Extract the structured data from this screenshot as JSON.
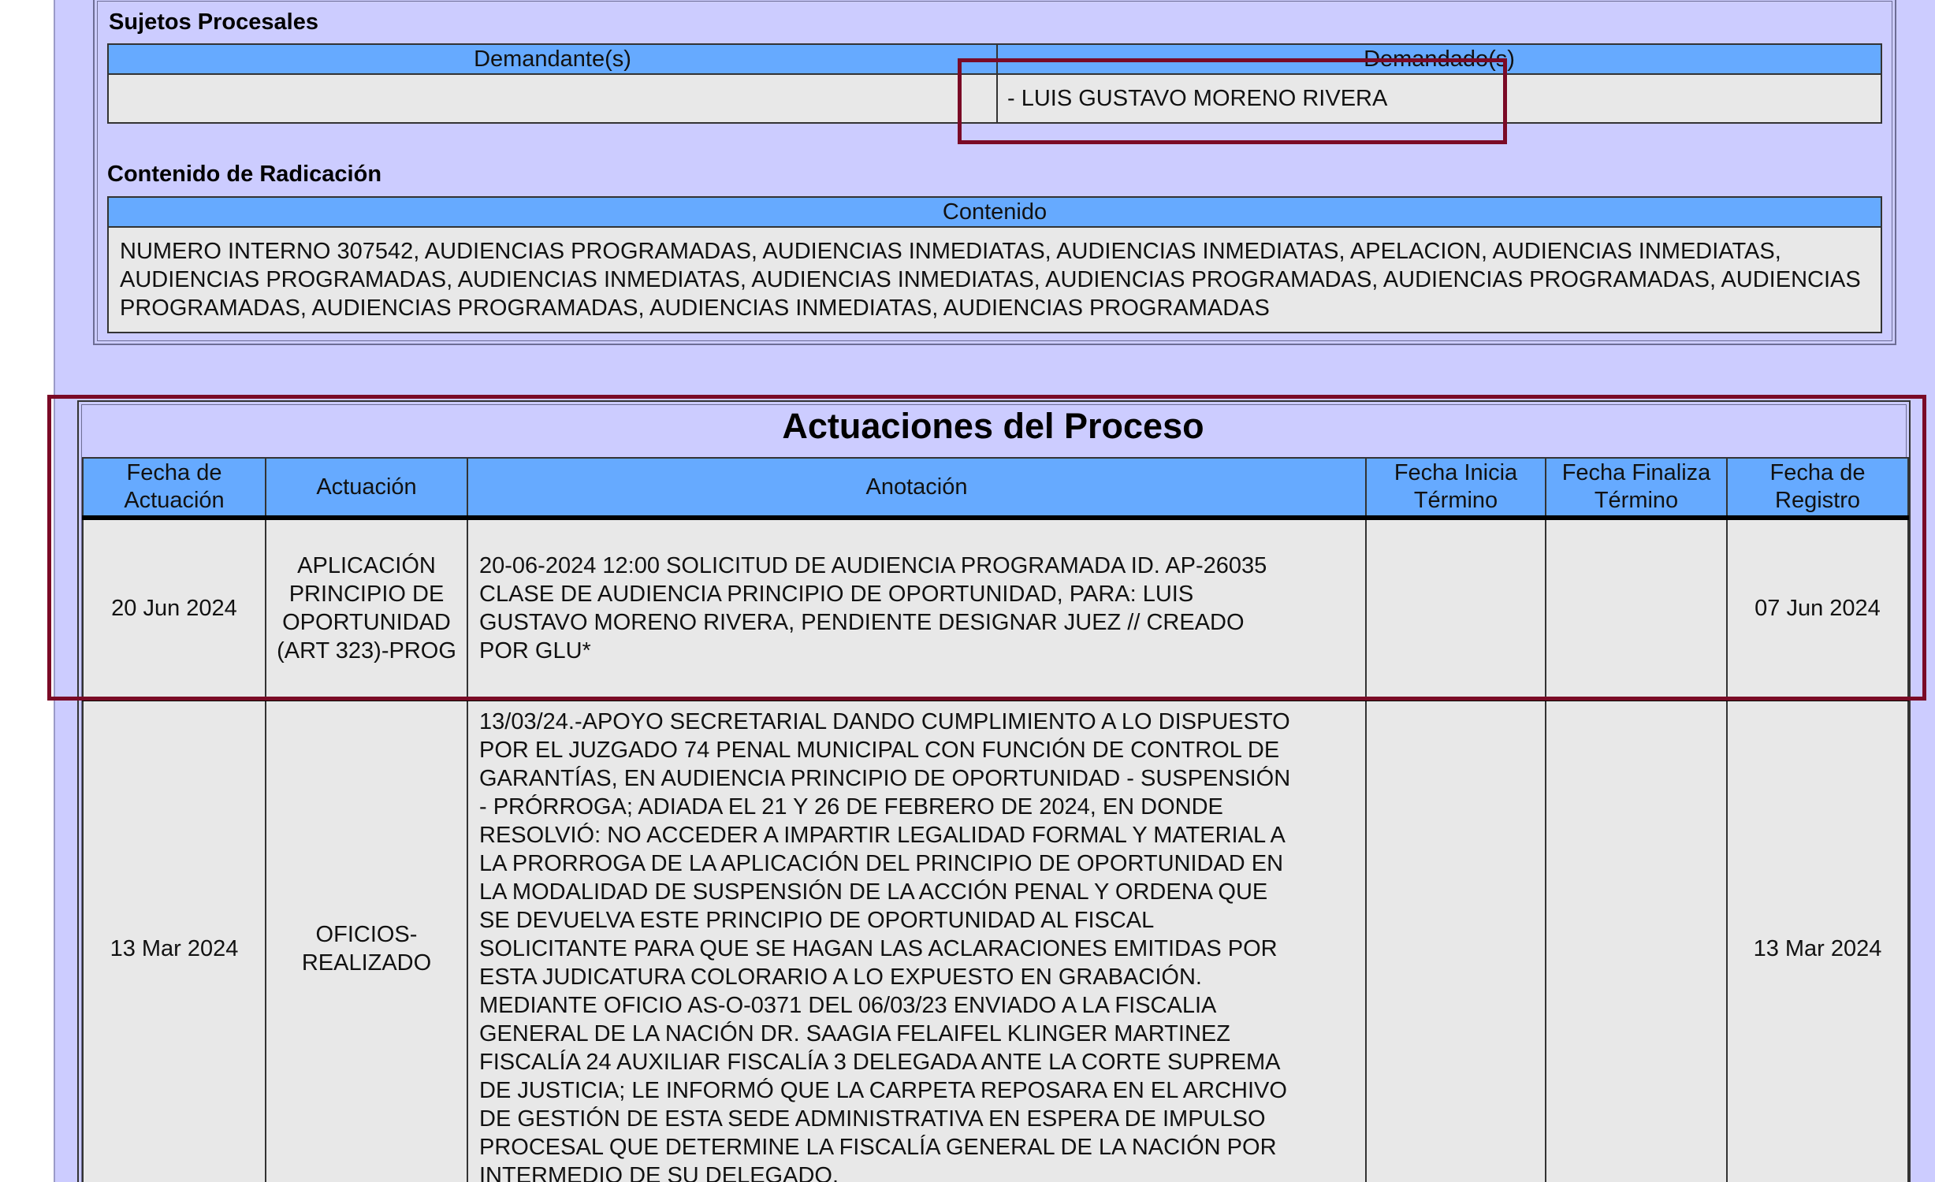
{
  "sujetos": {
    "title": "Sujetos Procesales",
    "headers": [
      "Demandante(s)",
      "Demandado(s)"
    ],
    "demandante": "",
    "demandado": "- LUIS GUSTAVO MORENO RIVERA"
  },
  "contenido": {
    "title": "Contenido de Radicación",
    "header": "Contenido",
    "text": "NUMERO INTERNO 307542, AUDIENCIAS PROGRAMADAS, AUDIENCIAS INMEDIATAS, AUDIENCIAS INMEDIATAS, APELACION, AUDIENCIAS INMEDIATAS, AUDIENCIAS PROGRAMADAS, AUDIENCIAS INMEDIATAS, AUDIENCIAS INMEDIATAS, AUDIENCIAS PROGRAMADAS, AUDIENCIAS PROGRAMADAS, AUDIENCIAS PROGRAMADAS, AUDIENCIAS PROGRAMADAS, AUDIENCIAS INMEDIATAS, AUDIENCIAS PROGRAMADAS"
  },
  "actuaciones": {
    "title": "Actuaciones del Proceso",
    "headers": {
      "fecha_actuacion": "Fecha de Actuación",
      "actuacion": "Actuación",
      "anotacion": "Anotación",
      "fecha_inicia": "Fecha Inicia Término",
      "fecha_finaliza": "Fecha Finaliza Término",
      "fecha_registro": "Fecha de Registro"
    },
    "rows": [
      {
        "fecha_actuacion": "20 Jun 2024",
        "actuacion": "APLICACIÓN PRINCIPIO DE OPORTUNIDAD (ART 323)-PROG",
        "anotacion": "20-06-2024 12:00 SOLICITUD DE AUDIENCIA PROGRAMADA ID. AP-26035\nCLASE DE AUDIENCIA PRINCIPIO DE OPORTUNIDAD, PARA: LUIS\nGUSTAVO MORENO RIVERA, PENDIENTE DESIGNAR JUEZ // CREADO\nPOR GLU*",
        "fecha_inicia": "",
        "fecha_finaliza": "",
        "fecha_registro": "07 Jun 2024"
      },
      {
        "fecha_actuacion": "13 Mar 2024",
        "actuacion": "OFICIOS-REALIZADO",
        "anotacion": "13/03/24.-APOYO SECRETARIAL DANDO CUMPLIMIENTO A LO DISPUESTO\nPOR EL JUZGADO 74 PENAL MUNICIPAL CON FUNCIÓN DE CONTROL DE\nGARANTÍAS, EN AUDIENCIA PRINCIPIO DE OPORTUNIDAD - SUSPENSIÓN\n- PRÓRROGA; ADIADA EL 21 Y 26 DE FEBRERO DE 2024, EN DONDE\nRESOLVIÓ: NO ACCEDER A IMPARTIR LEGALIDAD FORMAL Y MATERIAL A\nLA PRORROGA DE LA APLICACIÓN DEL PRINCIPIO DE OPORTUNIDAD EN\nLA MODALIDAD DE SUSPENSIÓN DE LA ACCIÓN PENAL Y ORDENA QUE\nSE DEVUELVA ESTE PRINCIPIO DE OPORTUNIDAD AL FISCAL\nSOLICITANTE PARA QUE SE HAGAN LAS ACLARACIONES EMITIDAS POR\nESTA JUDICATURA COLORARIO A LO EXPUESTO EN GRABACIÓN.\nMEDIANTE OFICIO AS-O-0371 DEL 06/03/23 ENVIADO A LA FISCALIA\nGENERAL DE LA NACIÓN DR. SAAGIA FELAIFEL KLINGER MARTINEZ\nFISCALÍA 24 AUXILIAR FISCALÍA 3 DELEGADA ANTE LA CORTE SUPREMA\nDE JUSTICIA; LE INFORMÓ QUE LA CARPETA REPOSARA EN EL ARCHIVO\nDE GESTIÓN DE ESTA SEDE ADMINISTRATIVA EN ESPERA DE IMPULSO\nPROCESAL QUE DETERMINE LA FISCALÍA GENERAL DE LA NACIÓN POR\nINTERMEDIO DE SU DELEGADO.",
        "fecha_inicia": "",
        "fecha_finaliza": "",
        "fecha_registro": "13 Mar 2024"
      }
    ]
  },
  "colors": {
    "panel_bg": "#ccccff",
    "header_bg": "#66aaff",
    "cell_bg": "#e8e8e8",
    "highlight": "#7a0a26"
  }
}
